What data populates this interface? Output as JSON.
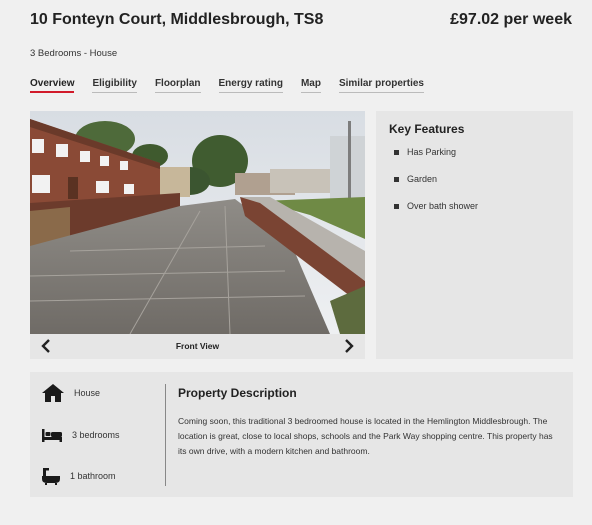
{
  "property": {
    "address": "10 Fonteyn Court, Middlesbrough, TS8",
    "price": "£97.02 per week",
    "summary": "3 Bedrooms - House"
  },
  "tabs": [
    {
      "label": "Overview",
      "active": true
    },
    {
      "label": "Eligibility",
      "active": false
    },
    {
      "label": "Floorplan",
      "active": false
    },
    {
      "label": "Energy rating",
      "active": false
    },
    {
      "label": "Map",
      "active": false
    },
    {
      "label": "Similar properties",
      "active": false
    }
  ],
  "gallery": {
    "caption": "Front View",
    "prev_icon": "chevron-left-icon",
    "next_icon": "chevron-right-icon"
  },
  "key_features": {
    "title": "Key Features",
    "items": [
      "Has Parking",
      "Garden",
      "Over bath shower"
    ]
  },
  "stats": {
    "type": {
      "label": "House",
      "icon": "house-icon"
    },
    "bedrooms": {
      "label": "3 bedrooms",
      "icon": "bed-icon"
    },
    "bathrooms": {
      "label": "1 bathroom",
      "icon": "bath-icon"
    }
  },
  "description": {
    "title": "Property Description",
    "text": "Coming soon, this traditional 3 bedroomed house is located in the Hemlington Middlesbrough. The location is great, close to local shops, schools and the Park Way shopping centre. This property has its own drive, with a modern kitchen and bathroom."
  },
  "colors": {
    "accent": "#d11a2a",
    "panel": "#e6e6e6",
    "background": "#f0f0f0"
  }
}
